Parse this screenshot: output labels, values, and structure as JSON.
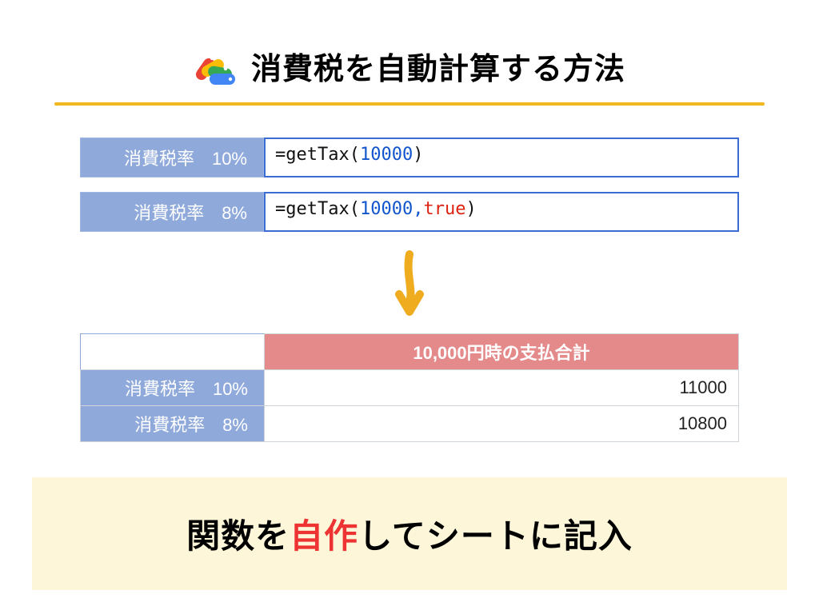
{
  "title": "消費税を自動計算する方法",
  "formulas": [
    {
      "label": "消費税率　10%",
      "parts": {
        "prefix": "=",
        "fn": "getTax",
        "open": "(",
        "args": "10000",
        "close": ")"
      }
    },
    {
      "label": "消費税率　8%",
      "parts": {
        "prefix": "=",
        "fn": "getTax",
        "open": "(",
        "args": "10000,",
        "bool": "true",
        "close": ")"
      }
    }
  ],
  "result": {
    "header": "10,000円時の支払合計",
    "rows": [
      {
        "label": "消費税率　10%",
        "value": "11000"
      },
      {
        "label": "消費税率　8%",
        "value": "10800"
      }
    ]
  },
  "callout": {
    "a": "関数を",
    "b": "自作",
    "c": "してシートに記入"
  }
}
